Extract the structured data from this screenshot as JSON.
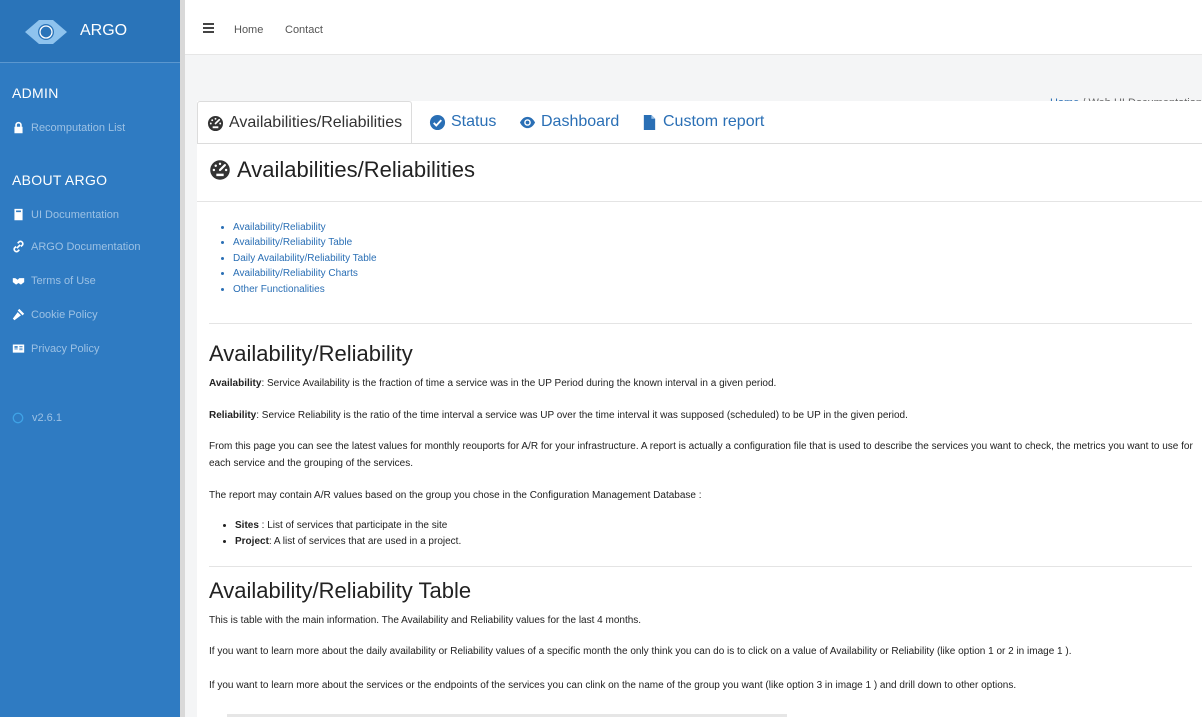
{
  "brand": {
    "name": "ARGO"
  },
  "sidebar": {
    "admin_heading": "ADMIN",
    "admin_items": [
      {
        "label": "Recomputation List",
        "icon": "lock-icon"
      }
    ],
    "about_heading": "ABOUT ARGO",
    "about_items": [
      {
        "label": "UI Documentation",
        "icon": "book-icon"
      },
      {
        "label": "ARGO Documentation",
        "icon": "link-icon"
      },
      {
        "label": "Terms of Use",
        "icon": "handshake-icon"
      },
      {
        "label": "Cookie Policy",
        "icon": "gavel-icon"
      },
      {
        "label": "Privacy Policy",
        "icon": "id-card-icon"
      }
    ],
    "version": "v2.6.1"
  },
  "topnav": {
    "home": "Home",
    "contact": "Contact"
  },
  "breadcrumb": {
    "home": "Home",
    "separator": " / ",
    "current": "Web UI Documentation"
  },
  "tabs": [
    {
      "label": "Availabilities/Reliabilities",
      "icon": "tachometer-icon",
      "active": true
    },
    {
      "label": "Status",
      "icon": "check-circle-icon",
      "active": false
    },
    {
      "label": "Dashboard",
      "icon": "eye-icon",
      "active": false
    },
    {
      "label": "Custom report",
      "icon": "file-icon",
      "active": false
    }
  ],
  "page_title": "Availabilities/Reliabilities",
  "toc": [
    "Availability/Reliability",
    "Availability/Reliability Table",
    "Daily Availability/Reliability Table",
    "Availability/Reliability Charts",
    "Other Functionalities"
  ],
  "section1": {
    "heading": "Availability/Reliability",
    "availability_term": "Availability",
    "availability_text": ": Service Availability is the fraction of time a service was in the UP Period during the known interval in a given period.",
    "reliability_term": "Reliability",
    "reliability_text": ": Service Reliability is the ratio of the time interval a service was UP over the time interval it was supposed (scheduled) to be UP in the given period.",
    "paragraph": "From this page you can see the latest values for monthly reouports for A/R for your infrastructure. A report is actually a configuration file that is used to describe the services you want to check, the metrics you want to use for each service and the grouping of the services.",
    "group_intro": "The report may contain A/R values based on the group you chose in the Configuration Management Database :",
    "groups": [
      {
        "term": "Sites",
        "text": " : List of services that participate in the site"
      },
      {
        "term": "Project",
        "text": ": A list of services that are used in a project."
      }
    ]
  },
  "section2": {
    "heading": "Availability/Reliability Table",
    "p1": "This is table with the main information. The Availability and Reliability values for the last 4 months.",
    "p2": "If you want to learn more about the daily availability or Reliability values of a specific month the only think you can do is to click on a value of Availability or Reliability (like option 1 or 2 in image 1 ).",
    "p3": "If you want to learn more about the services or the endpoints of the services you can clink on the name of the group you want (like option 3 in image 1 ) and drill down to other options."
  },
  "colors": {
    "sidebar": "#2f7bc2",
    "link": "#2a6fb5",
    "content_bg": "#f4f5f6"
  }
}
